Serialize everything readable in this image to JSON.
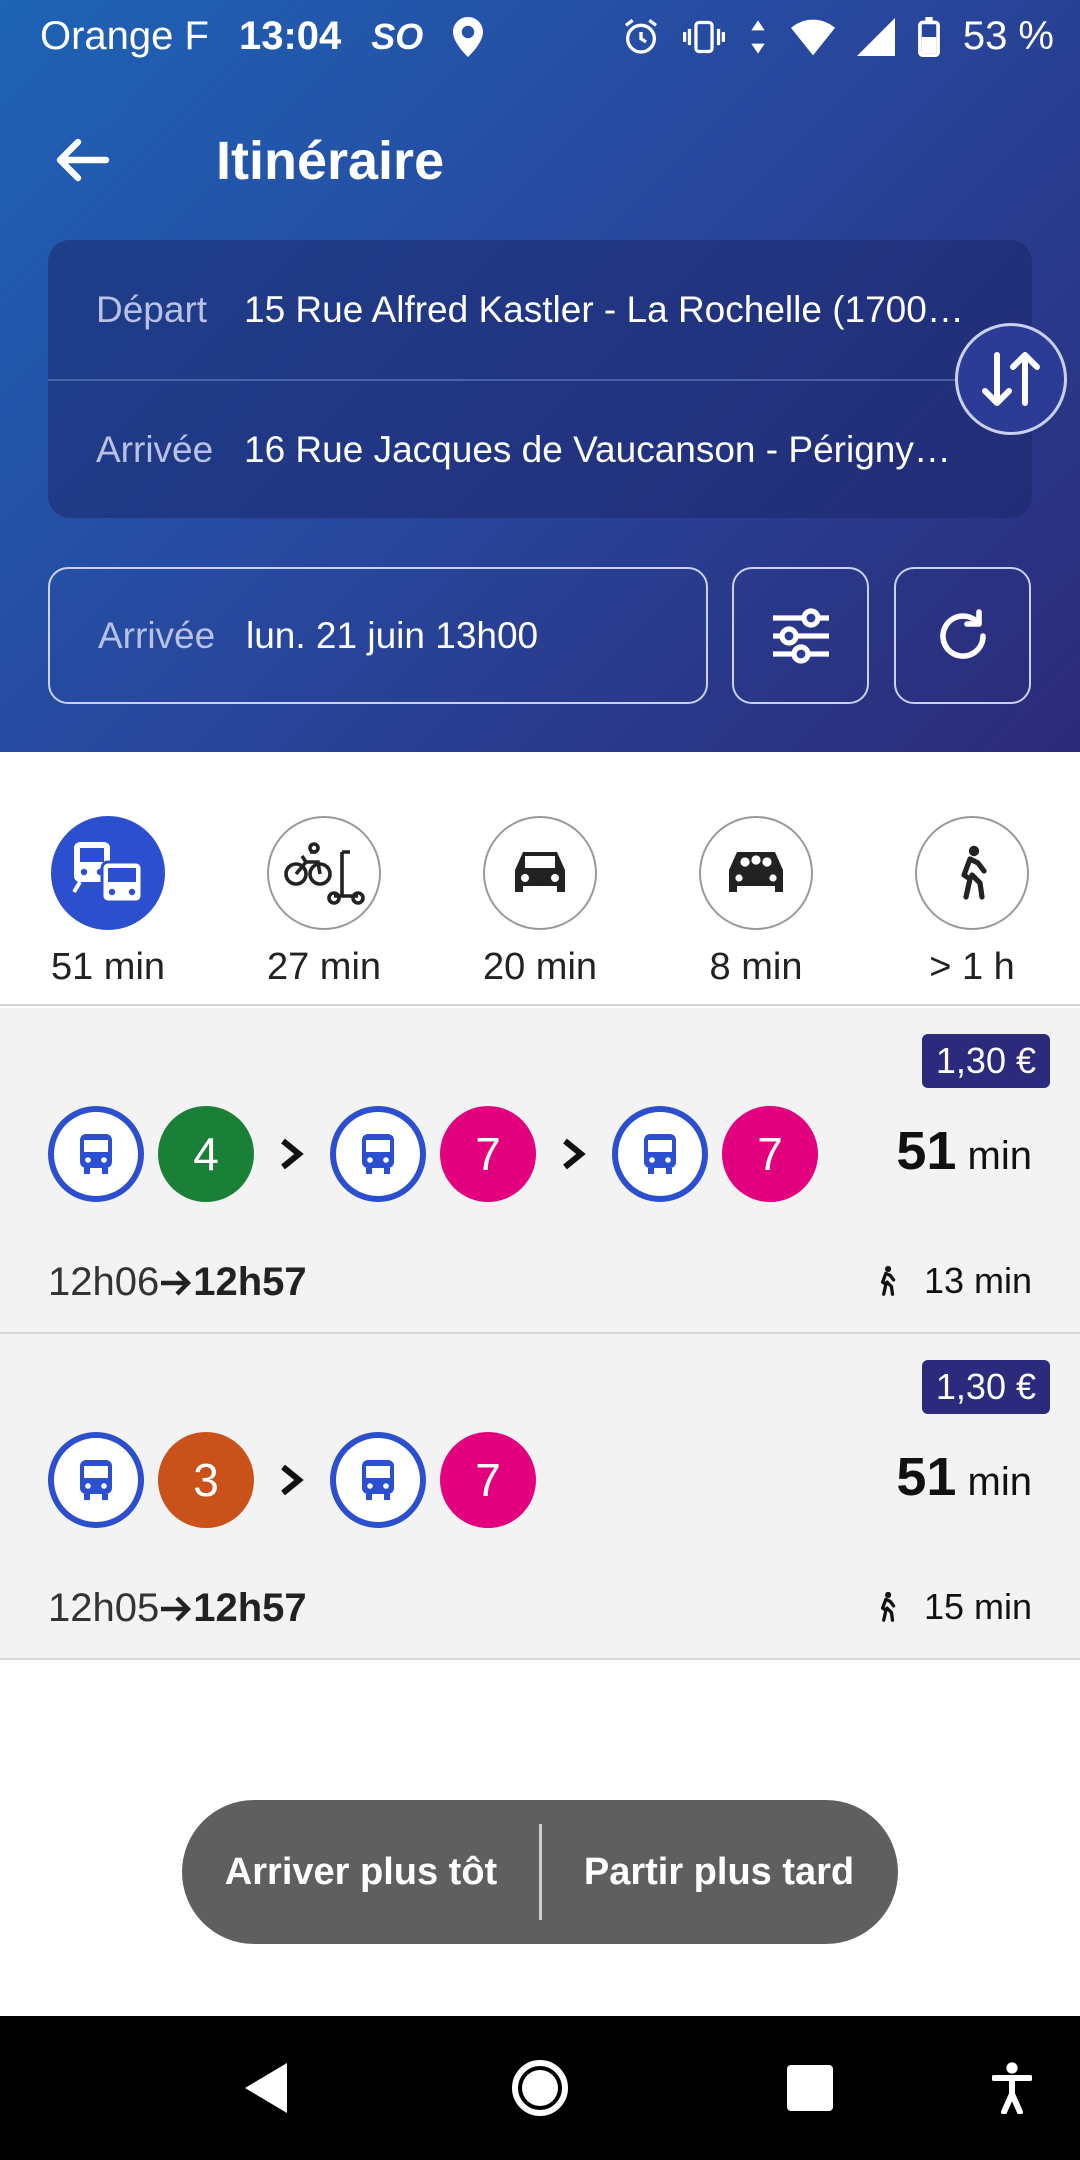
{
  "status_bar": {
    "carrier": "Orange F",
    "time": "13:04",
    "so_label": "SO",
    "battery": "53 %"
  },
  "header": {
    "title": "Itinéraire",
    "departure_label": "Départ",
    "departure_value": "15 Rue Alfred Kastler - La Rochelle (1700…",
    "arrival_label": "Arrivée",
    "arrival_value": "16 Rue Jacques de Vaucanson - Périgny…",
    "date_label": "Arrivée",
    "date_value": "lun. 21 juin 13h00"
  },
  "modes": [
    {
      "name": "public-transport",
      "duration": "51 min",
      "active": true
    },
    {
      "name": "bike-scooter",
      "duration": "27 min",
      "active": false
    },
    {
      "name": "car",
      "duration": "20 min",
      "active": false
    },
    {
      "name": "carpool",
      "duration": "8 min",
      "active": false
    },
    {
      "name": "walk",
      "duration": "> 1 h",
      "active": false
    }
  ],
  "results": [
    {
      "price": "1,30 €",
      "lines": [
        {
          "number": "4",
          "color": "#1a8038"
        },
        {
          "number": "7",
          "color": "#e3007e"
        },
        {
          "number": "7",
          "color": "#e3007e"
        }
      ],
      "duration_num": "51",
      "duration_unit": "min",
      "depart": "12h06",
      "arrive": "12h57",
      "walk": "13 min"
    },
    {
      "price": "1,30 €",
      "lines": [
        {
          "number": "3",
          "color": "#c9511a"
        },
        {
          "number": "7",
          "color": "#e3007e"
        }
      ],
      "duration_num": "51",
      "duration_unit": "min",
      "depart": "12h05",
      "arrive": "12h57",
      "walk": "15 min"
    }
  ],
  "actions": {
    "earlier": "Arriver plus tôt",
    "later": "Partir plus tard"
  },
  "colors": {
    "accent": "#2c4fd0",
    "price_bg": "#2b2a7c",
    "header_start": "#1e63b5",
    "header_end": "#2c2a78"
  }
}
